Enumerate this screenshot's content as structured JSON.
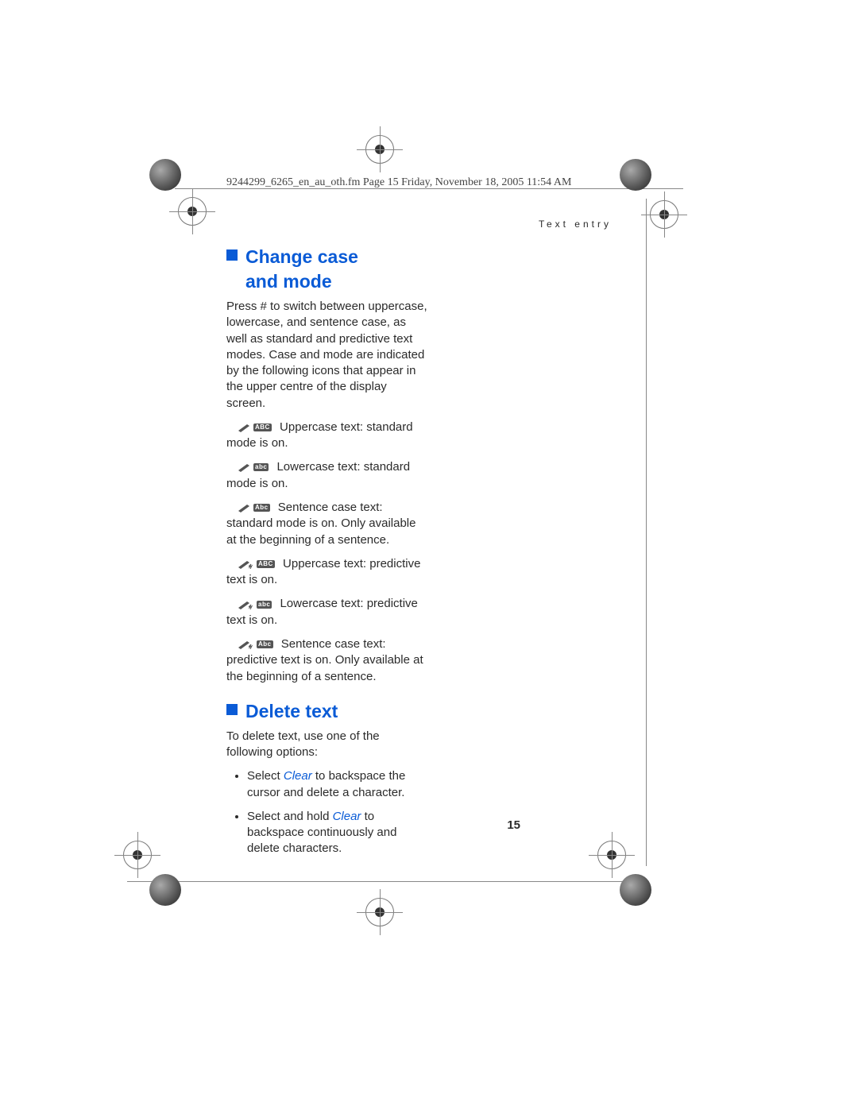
{
  "header_line": "9244299_6265_en_au_oth.fm  Page 15  Friday, November 18, 2005  11:54 AM",
  "section_label": "Text entry",
  "page_number": "15",
  "h_change": "Change case\nand mode",
  "p_change": "Press # to switch between uppercase, lowercase, and sentence case, as well as standard and predictive text modes. Case and mode are indicated by the following icons that appear in the upper centre of the display screen.",
  "modes": {
    "upper_std": {
      "tag": "ABC",
      "desc": "Uppercase text: standard mode is on."
    },
    "lower_std": {
      "tag": "abc",
      "desc": "Lowercase text: standard mode is on."
    },
    "sent_std": {
      "tag": "Abc",
      "desc": "Sentence case text: standard mode is on. Only available at the beginning of a sentence."
    },
    "upper_pred": {
      "tag": "ABC",
      "desc": "Uppercase text: predictive text is on."
    },
    "lower_pred": {
      "tag": "abc",
      "desc": "Lowercase text: predictive text is on."
    },
    "sent_pred": {
      "tag": "Abc",
      "desc": "Sentence case text: predictive text is on. Only available at the beginning of a sentence."
    }
  },
  "h_delete": "Delete text",
  "p_delete": "To delete text, use one of the following options:",
  "clear_label": "Clear",
  "bullets": {
    "b1a": "Select ",
    "b1b": " to backspace the cursor and delete a character.",
    "b2a": "Select and hold ",
    "b2b": " to backspace continuously and delete characters."
  }
}
